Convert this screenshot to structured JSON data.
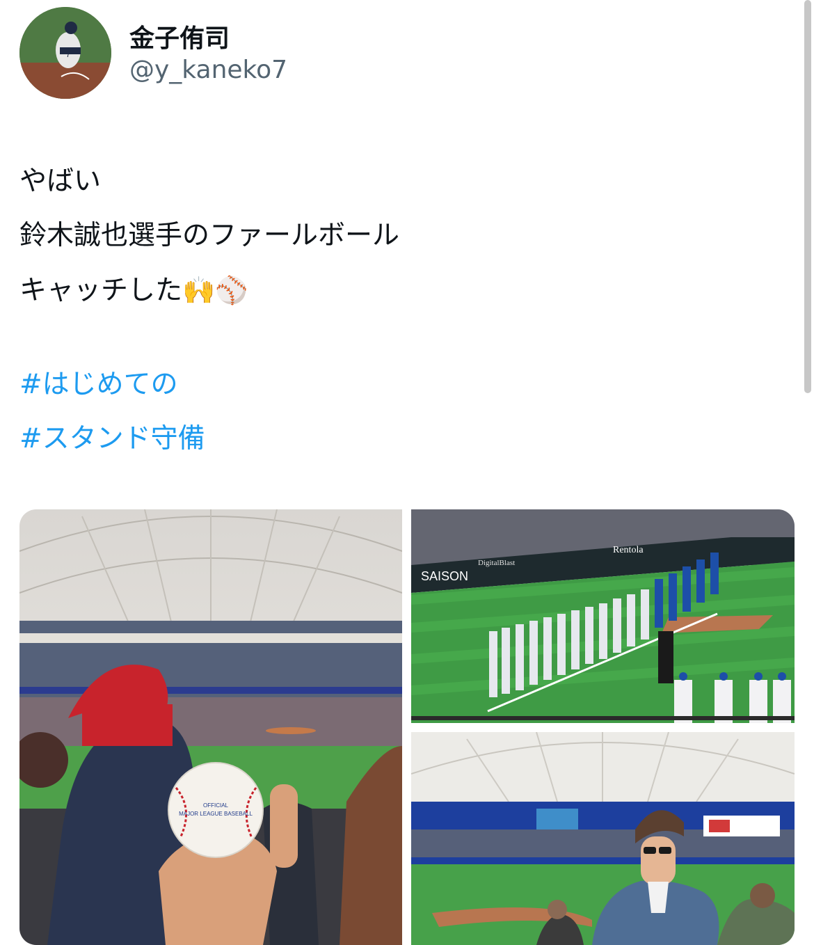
{
  "user": {
    "display_name": "金子侑司",
    "handle": "@y_kaneko7"
  },
  "tweet": {
    "lines": [
      "やばい",
      "鈴木誠也選手のファールボール",
      "キャッチした"
    ],
    "emojis": [
      "🙌",
      "⚾"
    ],
    "hashtags": [
      "#はじめての",
      "#スタンド守備"
    ]
  },
  "ball": {
    "text_official": "OFFICIAL",
    "text_mlb": "MAJOR LEAGUE BASEBALL"
  },
  "banners": {
    "saison": "SAISON",
    "rentola": "Rentola",
    "digitalblast": "DigitalBlast"
  },
  "colors": {
    "hashtag": "#1d9bf0",
    "text": "#0f1419",
    "muted": "#536471"
  }
}
